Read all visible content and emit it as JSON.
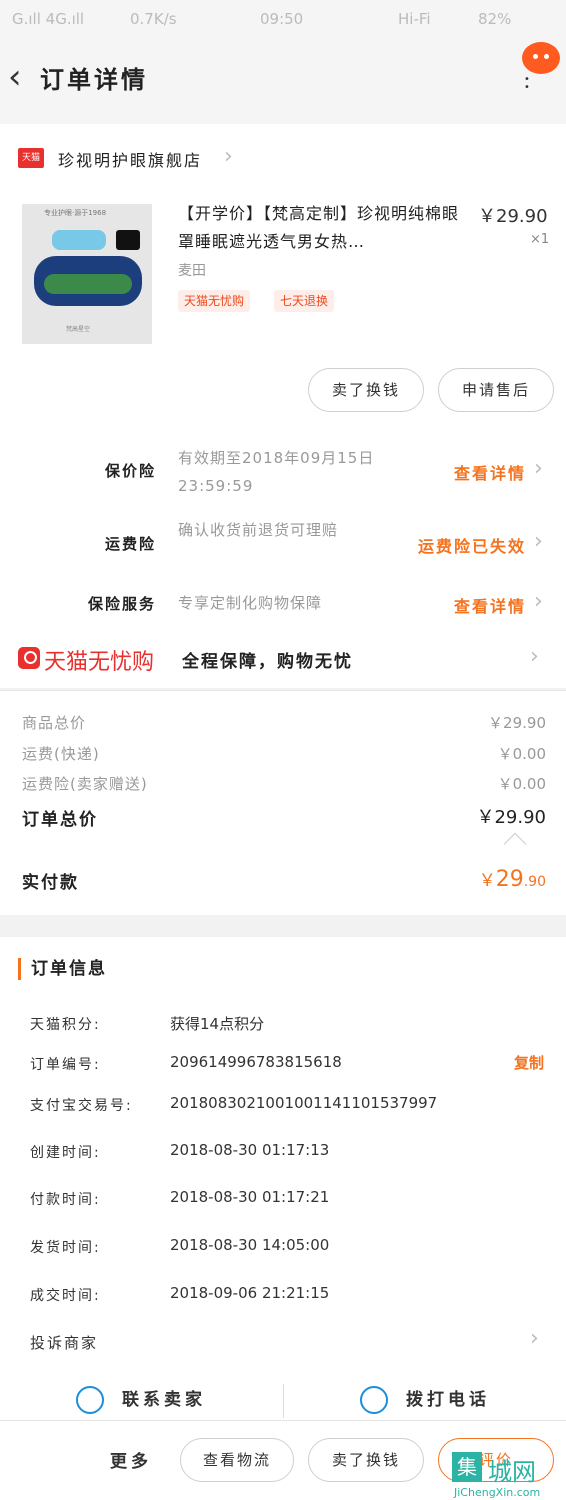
{
  "status_bar": {
    "carrier": "G.ıll 4G.ıll",
    "speed": "0.7K/s",
    "time": "09:50",
    "wifi": "Hi-Fi",
    "battery": "82%"
  },
  "nav": {
    "title": "订单详情",
    "back_icon": "chevron-left-icon",
    "more_icon": "more-vertical-icon"
  },
  "store": {
    "badge": "天猫",
    "name": "珍视明护眼旗舰店"
  },
  "product": {
    "image_tag": "专业护眼·源于1968",
    "image_footer": "梵高星空",
    "title": "【开学价】【梵高定制】珍视明纯棉眼罩睡眠遮光透气男女热…",
    "price": "￥29.90",
    "qty": "×1",
    "sku": "麦田",
    "tags": [
      "天猫无忧购",
      "七天退换"
    ]
  },
  "actions": {
    "sell_button": "卖了换钱",
    "after_sale_button": "申请售后"
  },
  "insurance": [
    {
      "label": "保价险",
      "desc": "有效期至2018年09月15日 23:59:59",
      "action": "查看详情"
    },
    {
      "label": "运费险",
      "desc": "确认收货前退货可理赔",
      "action": "运费险已失效"
    },
    {
      "label": "保险服务",
      "desc": "专享定制化购物保障",
      "action": "查看详情"
    }
  ],
  "wuyou": {
    "logo_text": "天猫无忧购",
    "slogan": "全程保障，购物无忧"
  },
  "fees": [
    {
      "label": "商品总价",
      "value": "￥29.90"
    },
    {
      "label": "运费(快递)",
      "value": "￥0.00"
    },
    {
      "label": "运费险(卖家赠送)",
      "value": "￥0.00"
    }
  ],
  "order_total": {
    "label": "订单总价",
    "value": "￥29.90"
  },
  "paid": {
    "label": "实付款",
    "currency": "￥",
    "integer": "29",
    "decimal": ".90"
  },
  "order_info": {
    "title": "订单信息",
    "copy_label": "复制",
    "rows": [
      {
        "label": "天猫积分:",
        "value": "获得14点积分"
      },
      {
        "label": "订单编号:",
        "value": "209614996783815618"
      },
      {
        "label": "支付宝交易号:",
        "value": "2018083021001001141101537997"
      },
      {
        "label": "创建时间:",
        "value": "2018-08-30 01:17:13"
      },
      {
        "label": "付款时间:",
        "value": "2018-08-30 01:17:21"
      },
      {
        "label": "发货时间:",
        "value": "2018-08-30 14:05:00"
      },
      {
        "label": "成交时间:",
        "value": "2018-09-06 21:21:15"
      }
    ],
    "complain": "投诉商家"
  },
  "contact": {
    "seller": "联系卖家",
    "phone": "拨打电话"
  },
  "bottom": {
    "more": "更多",
    "logistics": "查看物流",
    "sell": "卖了换钱",
    "review": "评价"
  },
  "watermark": {
    "glyph": "集",
    "text": "城网",
    "url": "JiChengXin.com"
  },
  "colors": {
    "accent": "#f5731f",
    "tmall_red": "#e8312f",
    "contact_blue": "#1d8fd9"
  }
}
